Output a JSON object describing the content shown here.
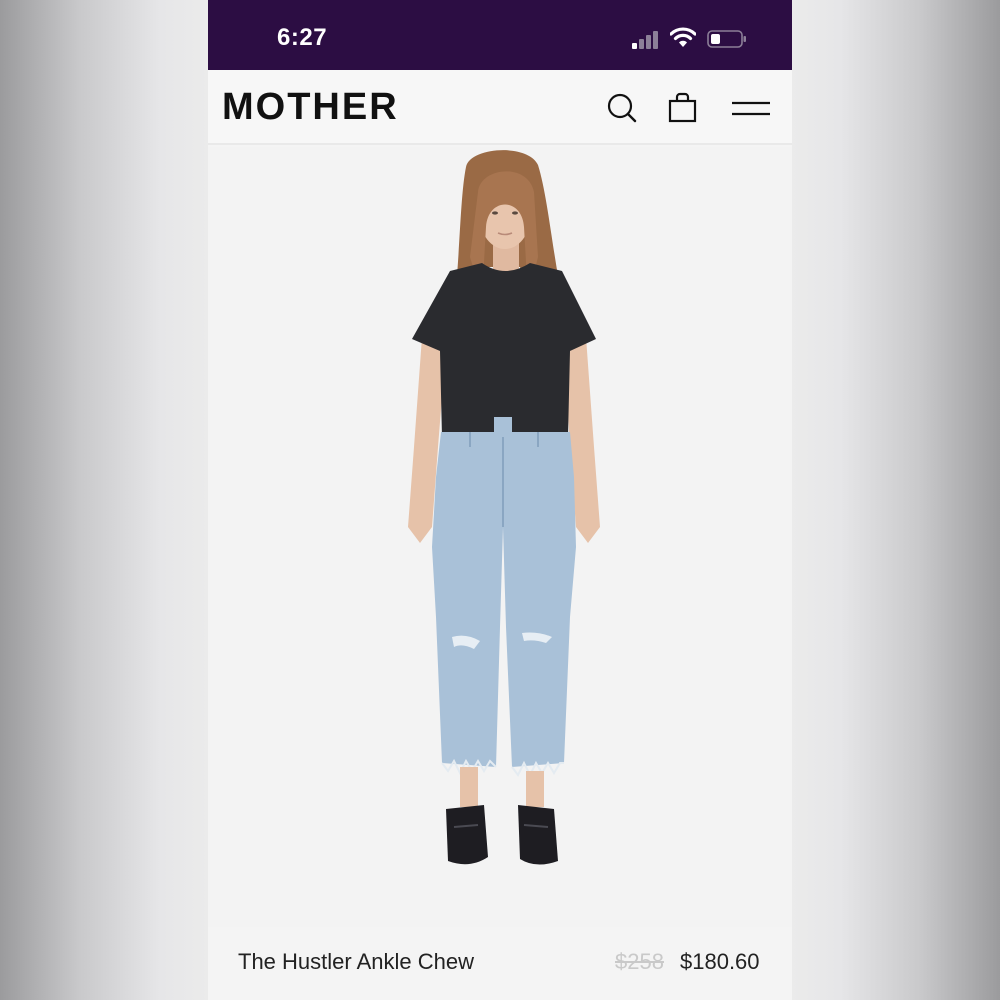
{
  "status_bar": {
    "time": "6:27",
    "signal_icon": "signal-bars-icon",
    "wifi_icon": "wifi-icon",
    "battery_icon": "battery-low-icon",
    "background_color": "#2c0d43"
  },
  "header": {
    "logo": "MOTHER",
    "icons": [
      "search-icon",
      "shopping-bag-icon",
      "menu-icon"
    ]
  },
  "product": {
    "image_alt": "model wearing light blue cropped flare jeans, black t-shirt and black loafers",
    "name": "The Hustler Ankle Chew",
    "original_price": "$258",
    "sale_price": "$180.60"
  }
}
